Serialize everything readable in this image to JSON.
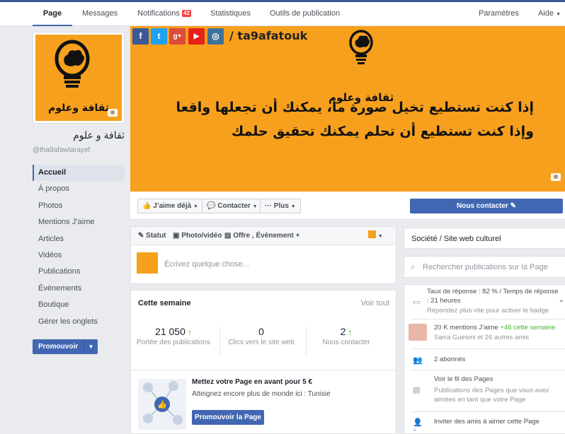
{
  "nav": {
    "tabs": [
      "Page",
      "Messages",
      "Notifications",
      "Statistiques",
      "Outils de publication"
    ],
    "notification_count": "42",
    "settings": "Paramètres",
    "help": "Aide"
  },
  "profile": {
    "name": "ثقافة و علوم",
    "handle": "@tha9afawtarayef",
    "logo_text": "ثقافة وعلوم"
  },
  "leftnav": [
    "Accueil",
    "À propos",
    "Photos",
    "Mentions J’aime",
    "Articles",
    "Vidéos",
    "Publications",
    "Évènements",
    "Boutique",
    "Gérer les onglets"
  ],
  "promote": "Promouvoir",
  "cover": {
    "handle": "/ ta9afatouk",
    "logo_text": "ثقافة وعلوم",
    "line1": "إذا كنت تستطيع تخيل صورة ما، يمكنك أن تجعلها واقعا",
    "line2": "وإذا كنت تستطيع أن تحلم يمكنك تحقيق حلمك",
    "social": [
      "f",
      "t",
      "g+",
      "▶",
      "◎"
    ]
  },
  "actions": {
    "like": "J’aime déjà",
    "contact": "Contacter",
    "more": "Plus",
    "contact_us": "Nous contacter"
  },
  "composer": {
    "status": "Statut",
    "photo": "Photo/vidéo",
    "offer": "Offre , Évènement +",
    "placeholder": "Écrivez quelque chose..."
  },
  "week": {
    "title": "Cette semaine",
    "see_all": "Voir tout",
    "stats": [
      {
        "value": "21 050",
        "label": "Portée des publications",
        "trend": "↑"
      },
      {
        "value": "0",
        "label": "Clics vers le site web",
        "trend": ""
      },
      {
        "value": "2",
        "label": "Nous contacter",
        "trend": "↑"
      }
    ],
    "promo_title": "Mettez votre Page en avant pour 5 €",
    "promo_sub": "Atteignez encore plus de monde ici : Tunisie",
    "promo_cta": "Promouvoir la Page"
  },
  "right": {
    "category": "Société / Site web culturel",
    "search_placeholder": "Rechercher publications sur la Page",
    "response_rate": "Taux de réponse : 82 % / Temps de réponse : 21 heures",
    "response_hint": "Répondez plus vite pour activer le badge",
    "likes": "20 K mentions J’aime",
    "likes_week": "+46 cette semaine",
    "likes_friends": "Sarra Guesmi et 26 autres amis",
    "subscribers": "2 abonnés",
    "feed_title": "Voir le fil des Pages",
    "feed_desc": "Publications des Pages que vous avez aimées en tant que votre Page",
    "invite": "Inviter des amis à aimer cette Page"
  },
  "colors": {
    "brand": "#4267b2",
    "cover": "#f7a01d",
    "up": "#42b72a",
    "badge": "#fa3e3e"
  }
}
